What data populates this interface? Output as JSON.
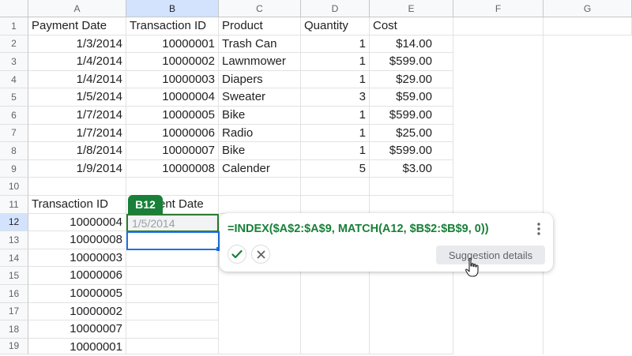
{
  "columns": [
    "A",
    "B",
    "C",
    "D",
    "E",
    "F",
    "G"
  ],
  "selected_column": "B",
  "rows": [
    "1",
    "2",
    "3",
    "4",
    "5",
    "6",
    "7",
    "8",
    "9",
    "10",
    "11",
    "12",
    "13",
    "14",
    "15",
    "16",
    "17",
    "18",
    "19"
  ],
  "selected_row": "12",
  "table": {
    "headers": [
      "Payment Date",
      "Transaction ID",
      "Product",
      "Quantity",
      "Cost"
    ],
    "records": [
      [
        "1/3/2014",
        "10000001",
        "Trash Can",
        "1",
        "$14.00"
      ],
      [
        "1/4/2014",
        "10000002",
        "Lawnmower",
        "1",
        "$599.00"
      ],
      [
        "1/4/2014",
        "10000003",
        "Diapers",
        "1",
        "$29.00"
      ],
      [
        "1/5/2014",
        "10000004",
        "Sweater",
        "3",
        "$59.00"
      ],
      [
        "1/7/2014",
        "10000005",
        "Bike",
        "1",
        "$599.00"
      ],
      [
        "1/7/2014",
        "10000006",
        "Radio",
        "1",
        "$25.00"
      ],
      [
        "1/8/2014",
        "10000007",
        "Bike",
        "1",
        "$599.00"
      ],
      [
        "1/9/2014",
        "10000008",
        "Calender",
        "5",
        "$3.00"
      ]
    ]
  },
  "lookup": {
    "header_a": "Transaction ID",
    "header_b_partial": "ent Date",
    "ids": [
      "10000004",
      "10000008",
      "10000003",
      "10000006",
      "10000005",
      "10000002",
      "10000007",
      "10000001"
    ],
    "ghost_value": "1/5/2014"
  },
  "cell_tag": "B12",
  "suggestion": {
    "formula": "=INDEX($A$2:$A$9, MATCH(A12, $B$2:$B$9, 0))",
    "details_label": "Suggestion details",
    "accept_icon": "checkmark-icon",
    "reject_icon": "close-icon",
    "menu_icon": "more-vert-icon"
  },
  "colors": {
    "accent_green": "#188038",
    "selection_blue": "#1a73e8",
    "header_selected": "#d3e3fd"
  }
}
